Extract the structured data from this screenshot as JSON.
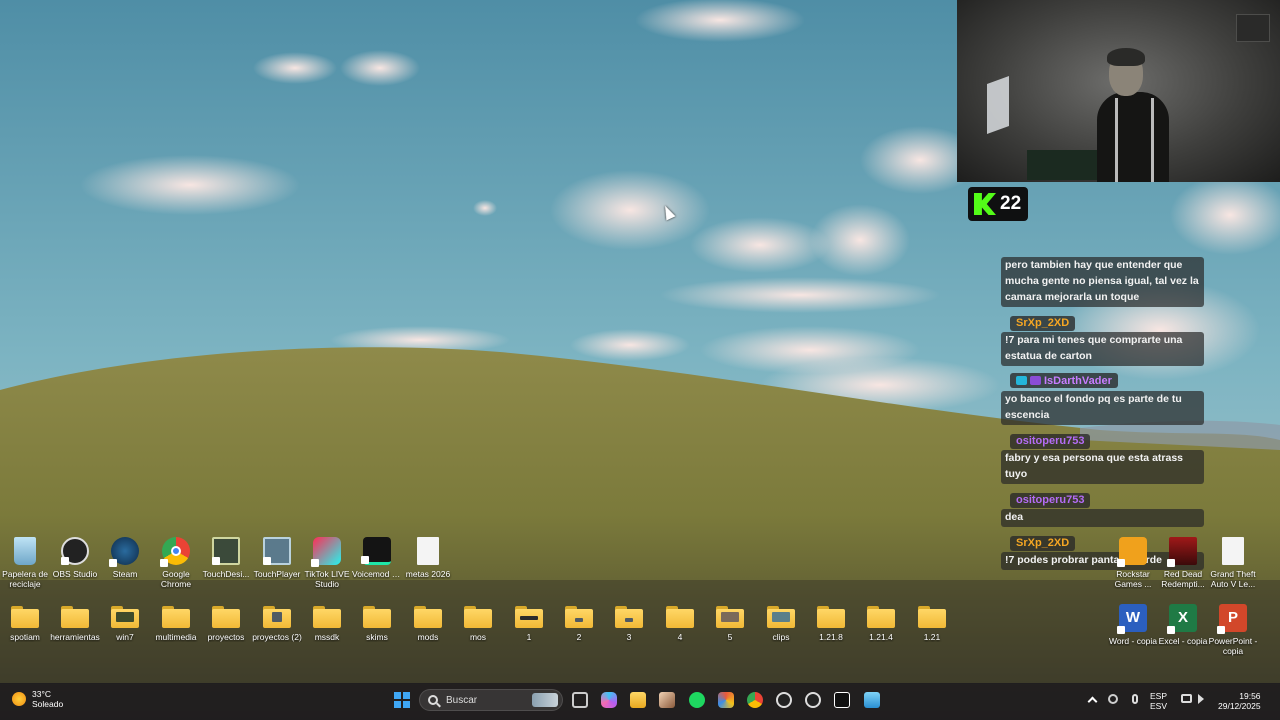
{
  "overlay": {
    "kick": {
      "viewer_count": "22",
      "accent": "#53fc18"
    },
    "chat": [
      {
        "user": "",
        "color": "#ffffff",
        "badge": "",
        "text": "pero tambien hay que entender que mucha gente no piensa igual, tal vez la camara mejorarla un toque"
      },
      {
        "user": "SrXp_2XD",
        "color": "#f5a623",
        "badge": "",
        "text": "!7 para mi tenes que comprarte una estatua de carton"
      },
      {
        "user": "IsDarthVader",
        "color": "#c77dff",
        "badge": "badge-icon",
        "text": "yo banco el fondo pq es parte de tu escencia"
      },
      {
        "user": "ositoperu753",
        "color": "#b46cf5",
        "badge": "",
        "text": "fabry y esa persona que esta atrass tuyo"
      },
      {
        "user": "ositoperu753",
        "color": "#b46cf5",
        "badge": "",
        "text": "dea"
      },
      {
        "user": "SrXp_2XD",
        "color": "#f5a623",
        "badge": "",
        "text": "!7 podes probrar pantalla verde"
      }
    ]
  },
  "desktop": {
    "apps": [
      {
        "name": "recycle-bin-icon",
        "label": "Papelera de reciclaje"
      },
      {
        "name": "obs-icon",
        "label": "OBS Studio"
      },
      {
        "name": "steam-icon",
        "label": "Steam"
      },
      {
        "name": "chrome-icon",
        "label": "Google Chrome"
      },
      {
        "name": "touchdesigner-icon",
        "label": "TouchDesi..."
      },
      {
        "name": "touchplayer-icon",
        "label": "TouchPlayer"
      },
      {
        "name": "tiktok-live-icon",
        "label": "TikTok LIVE Studio"
      },
      {
        "name": "voicemod-icon",
        "label": "Voicemod V3"
      },
      {
        "name": "document-icon",
        "label": "metas 2026"
      }
    ],
    "folders": [
      "spotiam",
      "herramientas",
      "win7",
      "multimedia",
      "proyectos",
      "proyectos (2)",
      "mssdk",
      "skims",
      "mods",
      "mos",
      "1",
      "2",
      "3",
      "4",
      "5",
      "clips",
      "1.21.8",
      "1.21.4",
      "1.21"
    ],
    "right_icons": [
      {
        "name": "rockstar-games-icon",
        "label": "Rockstar Games ..."
      },
      {
        "name": "red-dead-icon",
        "label": "Red Dead Redempti..."
      },
      {
        "name": "gta-file-icon",
        "label": "Grand Theft Auto V Le..."
      },
      {
        "name": "word-icon",
        "label": "Word - copia"
      },
      {
        "name": "excel-icon",
        "label": "Excel - copia"
      },
      {
        "name": "powerpoint-icon",
        "label": "PowerPoint - copia"
      }
    ]
  },
  "taskbar": {
    "weather_temp": "33°C",
    "weather_desc": "Soleado",
    "search_placeholder": "Buscar",
    "lang_line1": "ESP",
    "lang_line2": "ESV",
    "time": "19:56",
    "date": "29/12/2025",
    "pinned": [
      "task-view-icon",
      "copilot-icon",
      "file-explorer-icon",
      "photo-app-icon",
      "spotify-icon",
      "davinci-icon",
      "chrome-icon",
      "obs-icon",
      "media-player-icon",
      "capcut-icon",
      "notepad-icon"
    ]
  }
}
